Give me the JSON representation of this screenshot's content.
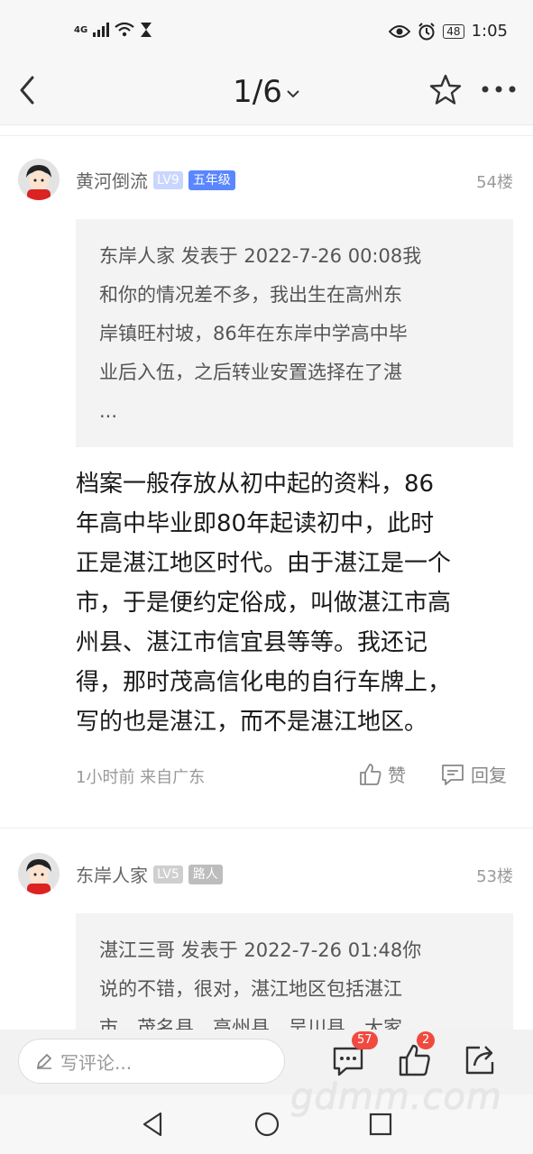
{
  "status_bar": {
    "network": "4G",
    "battery": "48",
    "time": "1:05"
  },
  "nav": {
    "title": "1/6"
  },
  "posts": [
    {
      "author": "黄河倒流",
      "level": "LV9",
      "grade": "五年级",
      "floor": "54楼",
      "quote_lines": [
        "东岸人家 发表于 2022-7-26 00:08我",
        "和你的情况差不多，我出生在高州东",
        "岸镇旺村坡，86年在东岸中学高中毕",
        "业后入伍，之后转业安置选择在了湛",
        "..."
      ],
      "content_lines": [
        "档案一般存放从初中起的资料，86",
        "年高中毕业即80年起读初中，此时",
        "正是湛江地区时代。由于湛江是一个",
        "市，于是便约定俗成，叫做湛江市高",
        "州县、湛江市信宜县等等。我还记",
        "得，那时茂高信化电的自行车牌上，",
        "写的也是湛江，而不是湛江地区。"
      ],
      "meta": "1小时前 来自广东",
      "like_label": "赞",
      "reply_label": "回复"
    },
    {
      "author": "东岸人家",
      "level": "LV5",
      "grade": "路人",
      "floor": "53楼",
      "quote_lines": [
        "湛江三哥 发表于 2022-7-26 01:48你",
        "说的不错，很对，湛江地区包括湛江",
        "市、茂名县、高州县、吴川县、大家"
      ]
    }
  ],
  "bottom": {
    "placeholder": "写评论...",
    "comment_count": "57",
    "like_count": "2"
  },
  "watermark": "gdmm.com"
}
